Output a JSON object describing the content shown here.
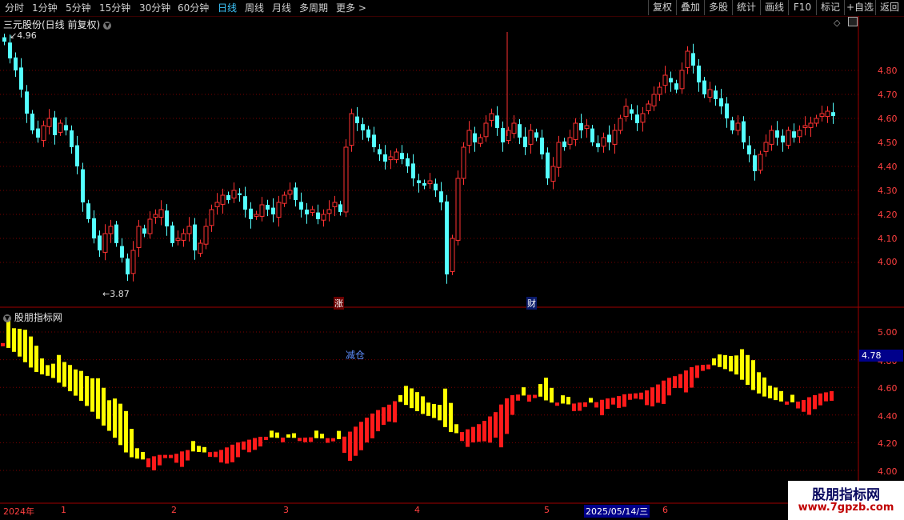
{
  "toolbar": {
    "periods": [
      "分时",
      "1分钟",
      "5分钟",
      "15分钟",
      "30分钟",
      "60分钟",
      "日线",
      "周线",
      "月线",
      "多周期",
      "更多 >"
    ],
    "active_period": "日线",
    "right_buttons": [
      "复权",
      "叠加",
      "多股",
      "统计",
      "画线",
      "F10",
      "标记",
      "+自选",
      "返回"
    ]
  },
  "main_panel": {
    "title": "三元股份(日线 前复权)",
    "high_marker": "4.96",
    "low_marker": "3.87",
    "event_labels": [
      "涨",
      "财"
    ],
    "y_ticks": [
      "4.80",
      "4.70",
      "4.60",
      "4.50",
      "4.40",
      "4.30",
      "4.20",
      "4.10",
      "4.00"
    ]
  },
  "indicator_panel": {
    "title": "股朋指标网",
    "signal_label": "减仓",
    "current_value": "4.78",
    "y_ticks": [
      "5.00",
      "4.80",
      "4.60",
      "4.40",
      "4.20",
      "4.00"
    ]
  },
  "date_axis": {
    "labels": [
      "2024年",
      "1",
      "2",
      "3",
      "4",
      "5",
      "6"
    ],
    "cursor_date": "2025/05/14/三"
  },
  "watermark": {
    "title": "股朋指标网",
    "url": "www.7gpzb.com"
  },
  "colors": {
    "up": "#ff3232",
    "down": "#54ffff",
    "indicator_red": "#ff1a1a",
    "indicator_yellow": "#ffff00",
    "grid": "#7a0000"
  },
  "chart_data": {
    "type": "candlestick",
    "ylim": [
      3.87,
      4.96
    ],
    "close_series": [
      4.92,
      4.85,
      4.8,
      4.72,
      4.62,
      4.55,
      4.52,
      4.57,
      4.6,
      4.53,
      4.58,
      4.55,
      4.48,
      4.4,
      4.25,
      4.18,
      4.1,
      4.05,
      4.12,
      4.15,
      4.08,
      4.02,
      3.95,
      4.05,
      4.15,
      4.12,
      4.18,
      4.2,
      4.22,
      4.15,
      4.08,
      4.1,
      4.12,
      4.15,
      4.05,
      4.08,
      4.15,
      4.22,
      4.25,
      4.28,
      4.26,
      4.3,
      4.28,
      4.22,
      4.18,
      4.2,
      4.24,
      4.22,
      4.2,
      4.25,
      4.28,
      4.3,
      4.26,
      4.22,
      4.2,
      4.22,
      4.18,
      4.2,
      4.22,
      4.25,
      4.21,
      4.48,
      4.62,
      4.58,
      4.55,
      4.52,
      4.48,
      4.45,
      4.42,
      4.44,
      4.46,
      4.43,
      4.4,
      4.35,
      4.33,
      4.32,
      4.34,
      4.3,
      4.25,
      3.95,
      4.1,
      4.35,
      4.48,
      4.55,
      4.5,
      4.52,
      4.58,
      4.62,
      4.56,
      4.5,
      4.55,
      4.58,
      4.52,
      4.48,
      4.55,
      4.52,
      4.45,
      4.35,
      4.4,
      4.5,
      4.48,
      4.52,
      4.58,
      4.55,
      4.57,
      4.5,
      4.48,
      4.52,
      4.5,
      4.55,
      4.6,
      4.65,
      4.62,
      4.58,
      4.62,
      4.66,
      4.7,
      4.73,
      4.78,
      4.75,
      4.72,
      4.8,
      4.88,
      4.82,
      4.75,
      4.7,
      4.72,
      4.68,
      4.65,
      4.6,
      4.55,
      4.58,
      4.5,
      4.45,
      4.38,
      4.45,
      4.5,
      4.55,
      4.52,
      4.5,
      4.55,
      4.52,
      4.55,
      4.57,
      4.58,
      4.6,
      4.62,
      4.63,
      4.61
    ]
  }
}
